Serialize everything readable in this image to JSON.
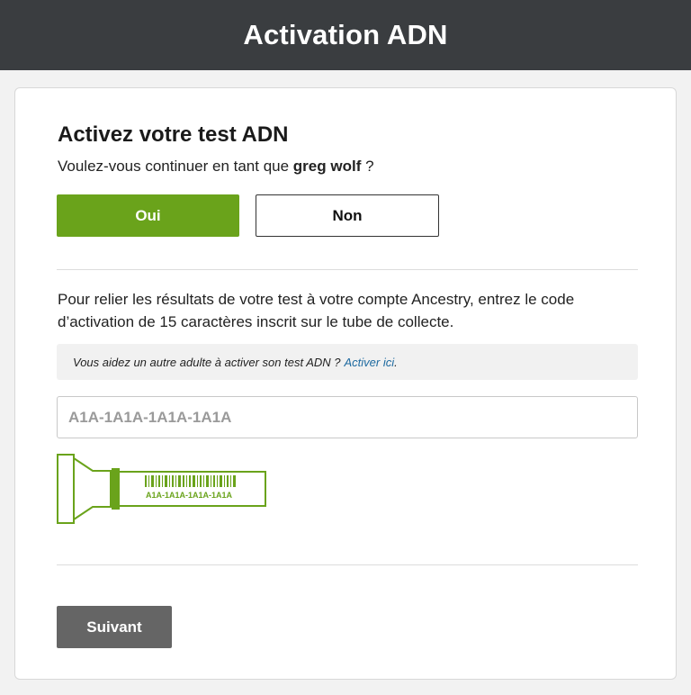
{
  "header": {
    "title": "Activation ADN"
  },
  "card": {
    "title": "Activez votre test ADN",
    "question_prefix": "Voulez-vous continuer en tant que ",
    "user_name": "greg wolf",
    "question_suffix": " ?",
    "yes_label": "Oui",
    "no_label": "Non",
    "instructions": "Pour relier les résultats de votre test à votre compte Ancestry, entrez le code d’activation de 15 caractères inscrit sur le tube de collecte.",
    "help_text": "Vous aidez un autre adulte à activer son test ADN ?",
    "help_link": "Activer ici",
    "help_end": ".",
    "code_placeholder": "A1A-1A1A-1A1A-1A1A",
    "tube_label": "A1A-1A1A-1A1A-1A1A",
    "next_label": "Suivant"
  },
  "colors": {
    "header_bg": "#3a3d40",
    "primary_green": "#6aa31b",
    "link_blue": "#1e6aa0",
    "next_button_bg": "#656565"
  }
}
